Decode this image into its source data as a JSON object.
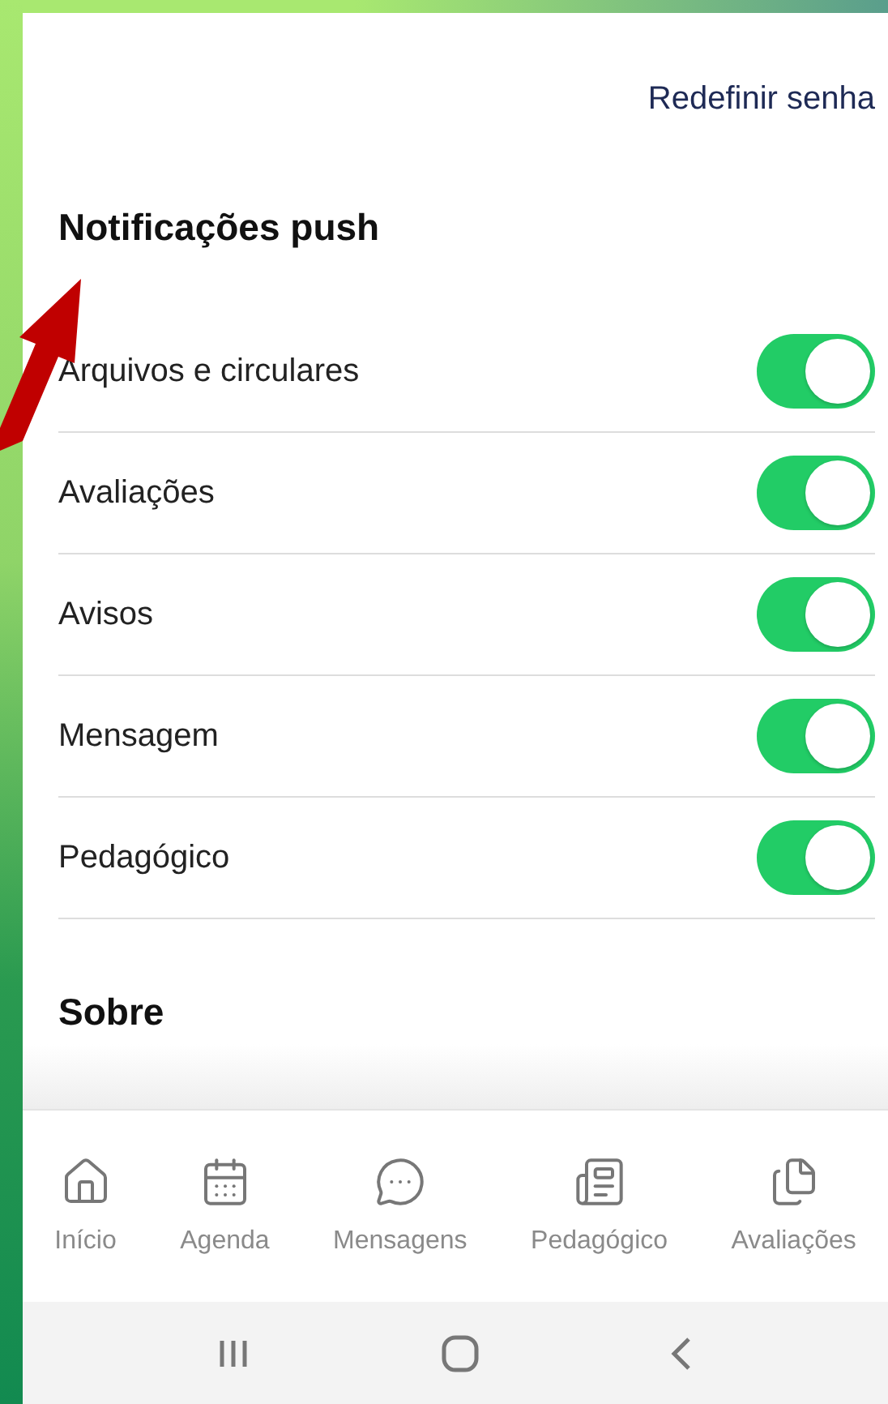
{
  "header": {
    "link": "Redefinir senha"
  },
  "push_section": {
    "title": "Notificações push",
    "items": [
      {
        "label": "Arquivos e circulares",
        "on": true
      },
      {
        "label": "Avaliações",
        "on": true
      },
      {
        "label": "Avisos",
        "on": true
      },
      {
        "label": "Mensagem",
        "on": true
      },
      {
        "label": "Pedagógico",
        "on": true
      }
    ]
  },
  "about_section": {
    "title": "Sobre"
  },
  "bottom_nav": [
    {
      "label": "Início",
      "kind": "home"
    },
    {
      "label": "Agenda",
      "kind": "calendar"
    },
    {
      "label": "Mensagens",
      "kind": "chat"
    },
    {
      "label": "Pedagógico",
      "kind": "news"
    },
    {
      "label": "Avaliações",
      "kind": "files"
    }
  ],
  "system_nav": [
    {
      "kind": "recents"
    },
    {
      "kind": "home"
    },
    {
      "kind": "back"
    }
  ]
}
